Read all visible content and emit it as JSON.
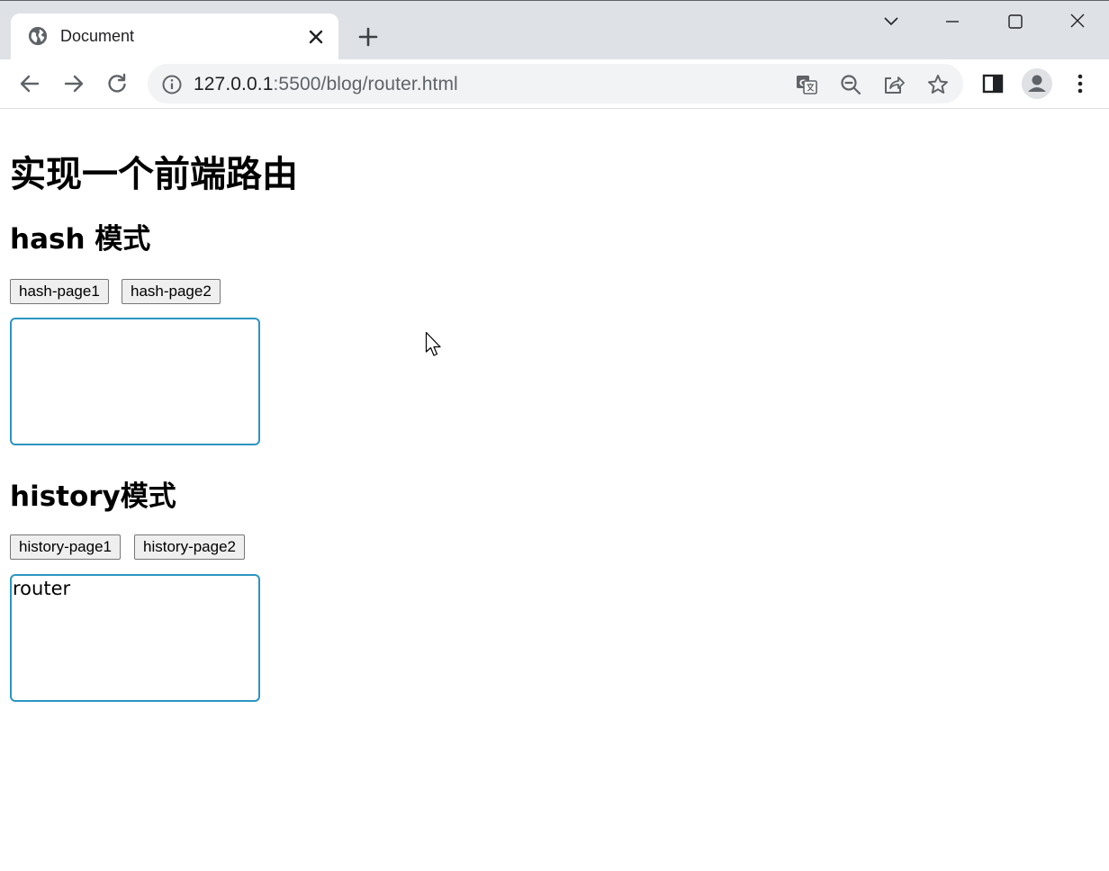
{
  "browser": {
    "tab_title": "Document",
    "url_host": "127.0.0.1",
    "url_rest": ":5500/blog/router.html",
    "icons": {
      "tab_favicon": "globe-icon",
      "tab_close": "close-icon",
      "new_tab": "plus-icon",
      "tab_search": "chevron-down-icon",
      "minimize": "minimize-icon",
      "maximize": "maximize-icon",
      "close_window": "close-icon",
      "back": "arrow-left-icon",
      "forward": "arrow-right-icon",
      "reload": "reload-icon",
      "site_info": "info-icon",
      "translate": "translate-icon",
      "zoom": "zoom-out-icon",
      "share": "share-icon",
      "bookmark": "star-icon",
      "side_panel": "side-panel-icon",
      "profile": "avatar-icon",
      "menu": "kebab-menu-icon"
    }
  },
  "page": {
    "title": "实现一个前端路由",
    "hash_section": {
      "heading": "hash 模式",
      "buttons": [
        "hash-page1",
        "hash-page2"
      ],
      "view_text": ""
    },
    "history_section": {
      "heading": "history模式",
      "buttons": [
        "history-page1",
        "history-page2"
      ],
      "view_text": "router"
    }
  },
  "colors": {
    "chrome_bg": "#dee1e6",
    "omnibox_bg": "#f1f3f4",
    "view_border": "#2b95c1",
    "button_bg": "#efefef"
  }
}
